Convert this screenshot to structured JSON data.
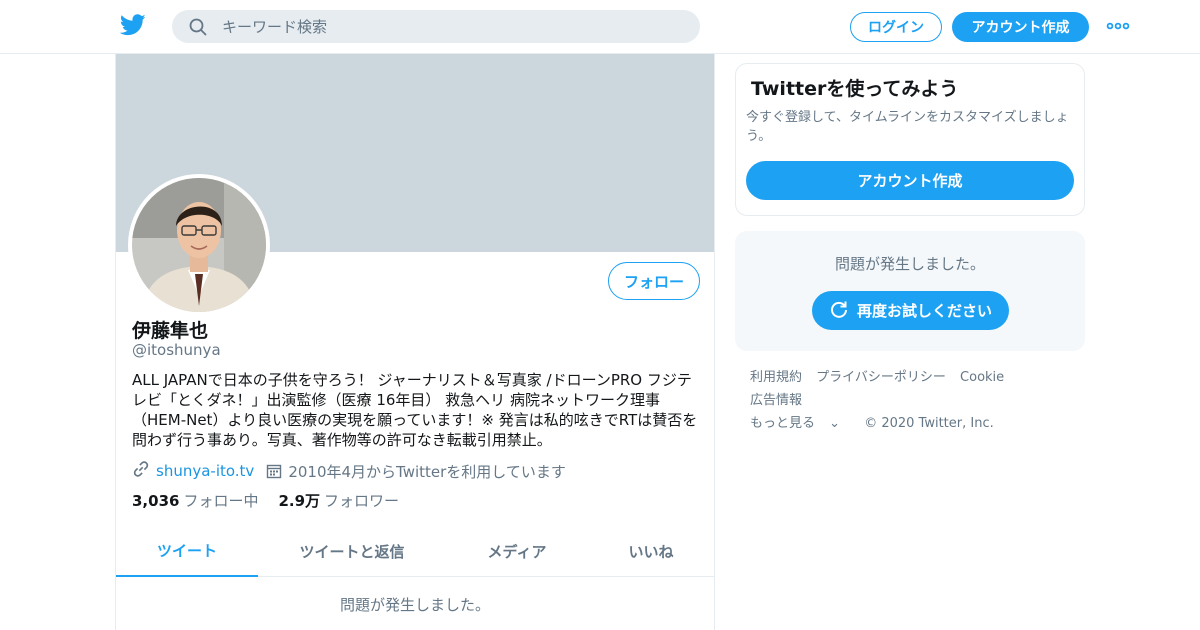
{
  "header": {
    "search_placeholder": "キーワード検索",
    "login_label": "ログイン",
    "signup_label": "アカウント作成"
  },
  "profile": {
    "follow_label": "フォロー",
    "name": "伊藤隼也",
    "handle": "@itoshunya",
    "bio": "ALL JAPANで日本の子供を守ろう！ ジャーナリスト＆写真家 /ドローンPRO フジテレビ「とくダネ！」出演監修（医療 16年目） 救急ヘリ 病院ネットワーク理事（HEM-Net）より良い医療の実現を願っています！※ 発言は私的呟きでRTは賛否を問わず行う事あり。写真、著作物等の許可なき転載引用禁止。",
    "website": "shunya-ito.tv",
    "joined": "2010年4月からTwitterを利用しています",
    "following_count": "3,036",
    "following_label": "フォロー中",
    "followers_count": "2.9万",
    "followers_label": "フォロワー"
  },
  "tabs": [
    {
      "label": "ツイート"
    },
    {
      "label": "ツイートと返信"
    },
    {
      "label": "メディア"
    },
    {
      "label": "いいね"
    }
  ],
  "timeline": {
    "error": "問題が発生しました。"
  },
  "signup_card": {
    "title": "Twitterを使ってみよう",
    "desc": "今すぐ登録して、タイムラインをカスタマイズしましょう。",
    "button": "アカウント作成"
  },
  "error_card": {
    "message": "問題が発生しました。",
    "retry_label": "再度お試しください"
  },
  "footer": {
    "links": [
      "利用規約",
      "プライバシーポリシー",
      "Cookie",
      "広告情報",
      "もっと見る"
    ],
    "copyright": "© 2020 Twitter, Inc."
  },
  "colors": {
    "accent": "#1da1f2",
    "banner": "#ccd6dd",
    "muted_text": "#657786"
  },
  "icons": [
    "twitter-bird-icon",
    "search-icon",
    "more-dots-icon",
    "link-icon",
    "calendar-icon",
    "refresh-icon",
    "chevron-down-icon"
  ]
}
